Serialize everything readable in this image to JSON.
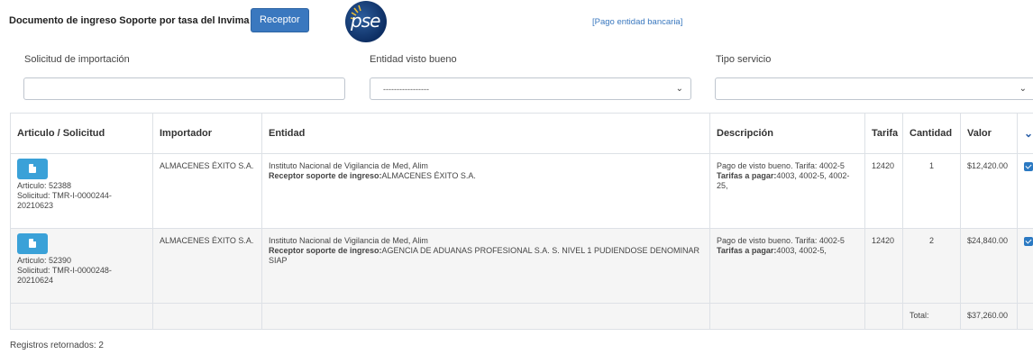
{
  "header": {
    "title": "Documento de ingreso Soporte por tasa del Invima",
    "receptor_button": "Receptor",
    "logo_text": "pse",
    "pago_link": "[Pago entidad bancaria]"
  },
  "filters": {
    "solicitud_label": "Solicitud de importación",
    "solicitud_value": "",
    "entidad_label": "Entidad visto bueno",
    "entidad_selected": "-----------------",
    "tipo_label": "Tipo servicio",
    "tipo_selected": ""
  },
  "table": {
    "columns": [
      "Articulo / Solicitud",
      "Importador",
      "Entidad",
      "Descripción",
      "Tarifa",
      "Cantidad",
      "Valor"
    ],
    "rows": [
      {
        "articulo": "Articulo: 52388",
        "solicitud": "Solicitud: TMR-I-0000244-20210623",
        "importador": "ALMACENES ÉXITO S.A.",
        "entidad": "Instituto Nacional de Vigilancia de Med, Alim",
        "receptor_label": "Receptor soporte de ingreso:",
        "receptor_value": "ALMACENES ÉXITO S.A.",
        "descripcion": "Pago de visto bueno. Tarifa: 4002-5",
        "tarifas_label": "Tarifas a pagar:",
        "tarifas_value": "4003, 4002-5, 4002-25,",
        "tarifa": "12420",
        "cantidad": "1",
        "valor": "$12,420.00",
        "checked": true
      },
      {
        "articulo": "Articulo: 52390",
        "solicitud": "Solicitud: TMR-I-0000248-20210624",
        "importador": "ALMACENES ÉXITO S.A.",
        "entidad": "Instituto Nacional de Vigilancia de Med, Alim",
        "receptor_label": "Receptor soporte de ingreso:",
        "receptor_value": "AGENCIA DE ADUANAS PROFESIONAL S.A. S. NIVEL 1 PUDIENDOSE DENOMINAR SIAP",
        "descripcion": "Pago de visto bueno. Tarifa: 4002-5",
        "tarifas_label": "Tarifas a pagar:",
        "tarifas_value": "4003, 4002-5,",
        "tarifa": "12420",
        "cantidad": "2",
        "valor": "$24,840.00",
        "checked": true
      }
    ],
    "total_label": "Total:",
    "total_value": "$37,260.00"
  },
  "footer": {
    "registros": "Registros retornados: 2"
  },
  "colors": {
    "primary": "#3a78bf",
    "doc_button": "#3aa1d8",
    "checkbox": "#2b79c2"
  }
}
